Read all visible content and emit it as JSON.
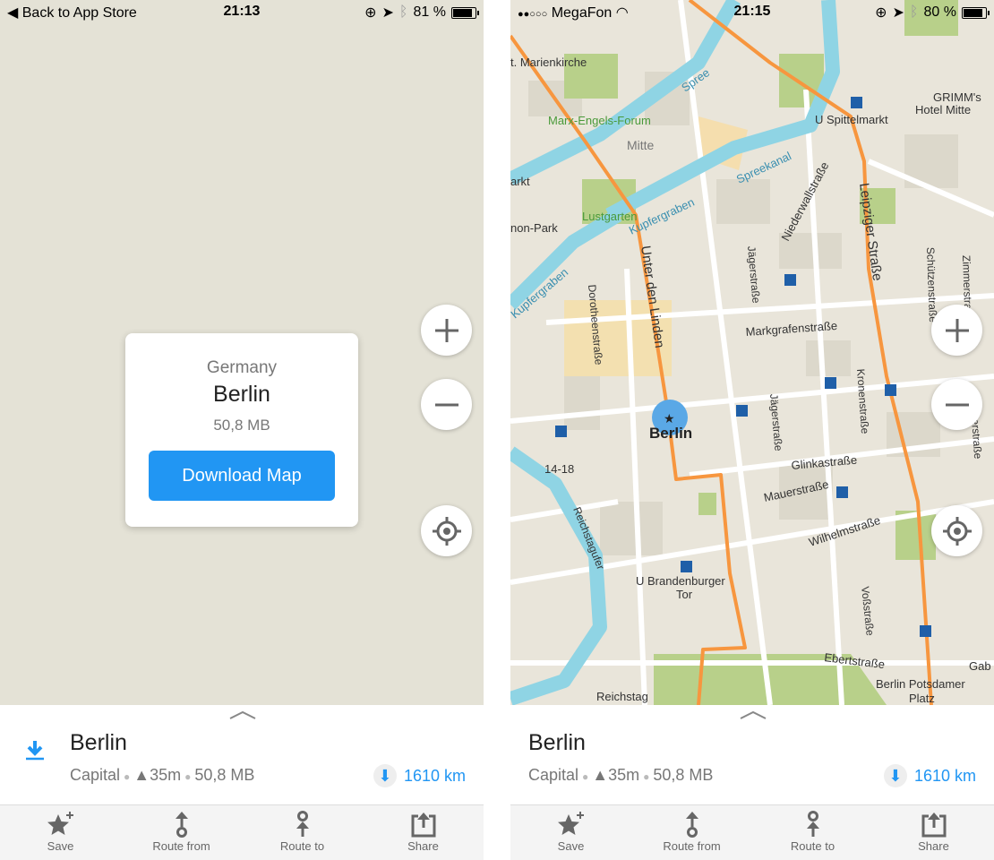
{
  "left": {
    "status": {
      "back": "Back to App Store",
      "time": "21:13",
      "battery": "81 %",
      "battery_level": 0.81
    },
    "card": {
      "country": "Germany",
      "city": "Berlin",
      "size": "50,8 MB",
      "download_label": "Download Map"
    },
    "sheet": {
      "title": "Berlin",
      "type": "Capital",
      "elevation": "35m",
      "size": "50,8 MB",
      "distance": "1610 km"
    }
  },
  "right": {
    "status": {
      "carrier": "MegaFon",
      "signal": "●●○○○",
      "time": "21:15",
      "battery": "80 %",
      "battery_level": 0.8
    },
    "map": {
      "labels": [
        "t. Marienkirche",
        "Marx-Engels-Forum",
        "Mitte",
        "arkt",
        "Lustgarten",
        "non-Park",
        "Spree",
        "Spreekanal",
        "Kupfergraben",
        "Kupfergraben",
        "U Spittelmarkt",
        "GRIMM's",
        "Hotel Mitte",
        "Niederwallstraße",
        "Leipziger Straße",
        "Unter den Linden",
        "Jägerstraße",
        "Schützenstraße",
        "Zimmerstraße",
        "Dorotheenstraße",
        "Markgrafenstraße",
        "Jägerstraße",
        "Kronenstraße",
        "Zimmerstraße",
        "Glinkastraße",
        "Mauerstraße",
        "Wilhelmstraße",
        "Reichstagufer",
        "14-18",
        "U Brandenburger",
        "Tor",
        "Voßstraße",
        "Ebertstraße",
        "Reichstag",
        "Berlin Potsdamer",
        "Platz",
        "Gab"
      ],
      "city_label": "Berlin"
    },
    "sheet": {
      "title": "Berlin",
      "type": "Capital",
      "elevation": "35m",
      "size": "50,8 MB",
      "distance": "1610 km"
    }
  },
  "toolbar": [
    "Save",
    "Route from",
    "Route to",
    "Share"
  ],
  "colors": {
    "accent": "#2196f3",
    "route": "#f7963f",
    "water": "#8fd4e4",
    "park": "#b8d08a"
  }
}
